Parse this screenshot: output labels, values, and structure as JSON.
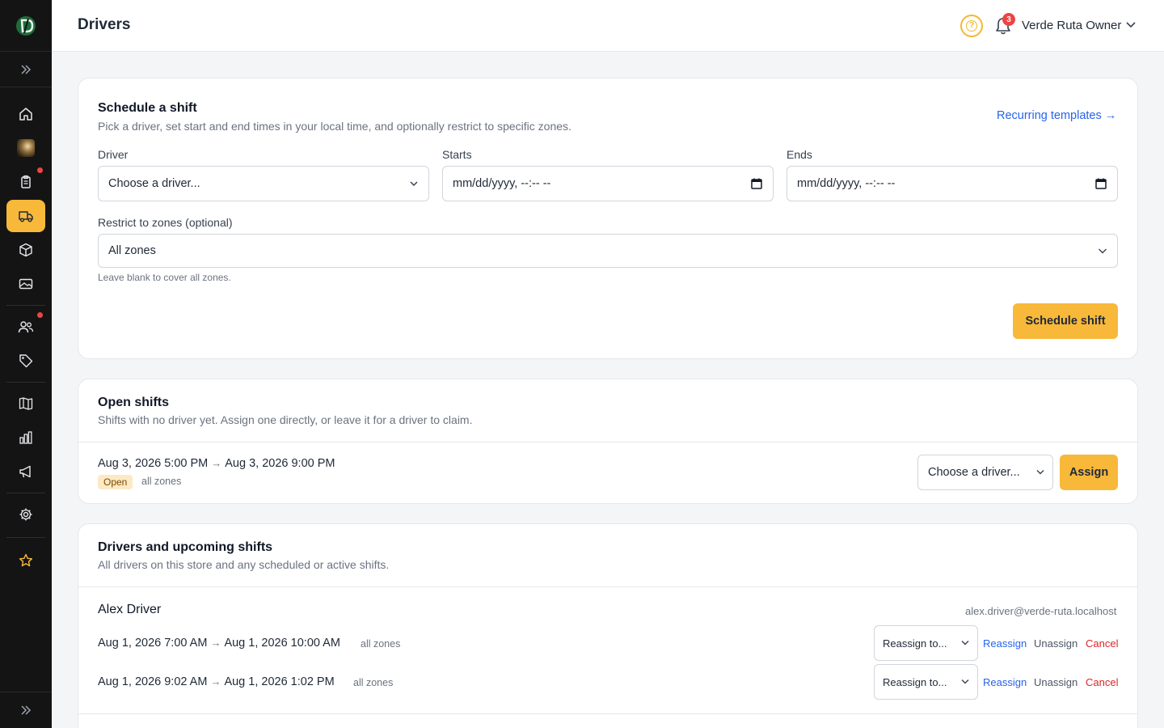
{
  "header": {
    "page_title": "Drivers",
    "notifications_count": "3",
    "user_name": "Verde Ruta Owner"
  },
  "sidebar": {
    "items": [
      {
        "icon": "home-icon"
      },
      {
        "icon": "avatar-image-icon"
      },
      {
        "icon": "clipboard-icon",
        "badge": true
      },
      {
        "icon": "truck-icon",
        "active": true
      },
      {
        "icon": "box-icon"
      },
      {
        "icon": "image-icon"
      },
      {
        "icon": "users-icon",
        "badge": true
      },
      {
        "icon": "tag-icon"
      },
      {
        "icon": "book-icon"
      },
      {
        "icon": "bar-chart-icon"
      },
      {
        "icon": "megaphone-icon"
      },
      {
        "icon": "gear-icon"
      },
      {
        "icon": "star-icon"
      }
    ]
  },
  "schedule": {
    "title": "Schedule a shift",
    "subtitle": "Pick a driver, set start and end times in your local time, and optionally restrict to specific zones.",
    "recurring_link": "Recurring templates →",
    "driver_label": "Driver",
    "driver_value": "Choose a driver...",
    "starts_label": "Starts",
    "starts_value": "mm/dd/yyyy, --:-- --",
    "ends_label": "Ends",
    "ends_value": "mm/dd/yyyy, --:-- --",
    "zones_label": "Restrict to zones (optional)",
    "zones_value": "All zones",
    "zones_hint": "Leave blank to cover all zones.",
    "submit_label": "Schedule shift"
  },
  "open_shifts": {
    "title": "Open shifts",
    "subtitle": "Shifts with no driver yet. Assign one directly, or leave it for a driver to claim.",
    "items": [
      {
        "start": "Aug 3, 2026 5:00 PM",
        "end": "Aug 3, 2026 9:00 PM",
        "status": "Open",
        "zones": "all zones",
        "select_value": "Choose a driver...",
        "assign_label": "Assign"
      }
    ]
  },
  "drivers": {
    "title": "Drivers and upcoming shifts",
    "subtitle": "All drivers on this store and any scheduled or active shifts.",
    "list": [
      {
        "name": "Alex Driver",
        "email": "alex.driver@verde-ruta.localhost",
        "shifts": [
          {
            "start": "Aug 1, 2026 7:00 AM",
            "end": "Aug 1, 2026 10:00 AM",
            "zones": "all zones",
            "select_value": "Reassign to...",
            "reassign": "Reassign",
            "unassign": "Unassign",
            "cancel": "Cancel"
          },
          {
            "start": "Aug 1, 2026 9:02 AM",
            "end": "Aug 1, 2026 1:02 PM",
            "zones": "all zones",
            "select_value": "Reassign to...",
            "reassign": "Reassign",
            "unassign": "Unassign",
            "cancel": "Cancel"
          }
        ]
      }
    ]
  },
  "colors": {
    "accent": "#f8b83a",
    "link": "#2563eb",
    "danger": "#dc2626",
    "sidebar_bg": "#141414"
  }
}
